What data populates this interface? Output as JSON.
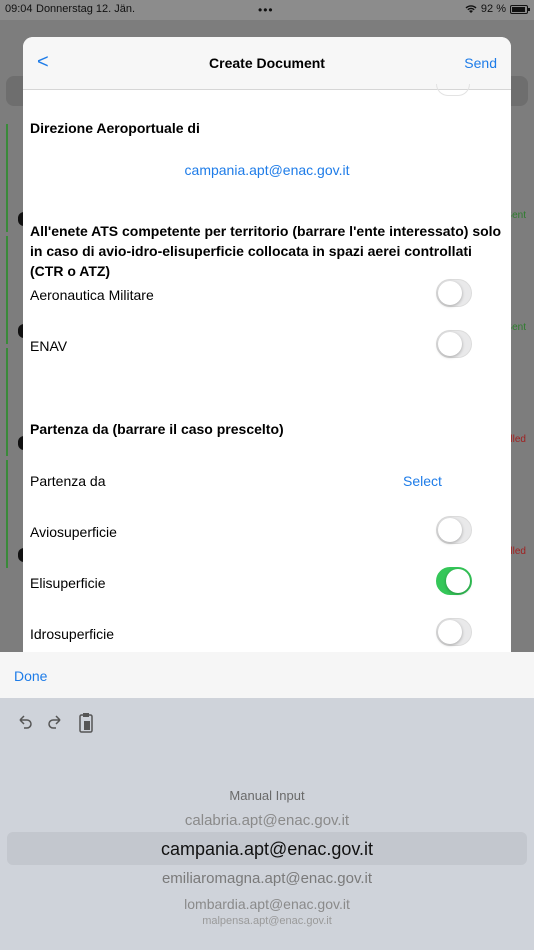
{
  "status": {
    "time": "09:04",
    "date": "Donnerstag 12. Jän.",
    "battery": "92 %"
  },
  "background": {
    "statuses": [
      "Sent",
      "Sent",
      "lled",
      "lled"
    ]
  },
  "header": {
    "back": "<",
    "title": "Create Document",
    "send": "Send"
  },
  "sections": {
    "direzione": {
      "title": "Direzione Aeroportuale di",
      "email": "campania.apt@enac.gov.it"
    },
    "ats": {
      "title": "All'enete ATS competente per territorio (barrare l'ente interessato) solo in caso di avio-idro-elisuperficie collocata in spazi aerei controllati (CTR o ATZ)",
      "rows": [
        {
          "label": "Aeronautica Militare",
          "on": false
        },
        {
          "label": "ENAV",
          "on": false
        }
      ]
    },
    "partenza": {
      "title": "Partenza da (barrare il caso prescelto)",
      "select_label": "Partenza da",
      "select_value": "Select",
      "rows": [
        {
          "label": "Aviosuperficie",
          "on": false
        },
        {
          "label": "Elisuperficie",
          "on": true
        },
        {
          "label": "Idrosuperficie",
          "on": false
        }
      ]
    }
  },
  "done": "Done",
  "picker": {
    "options": [
      "Manual Input",
      "calabria.apt@enac.gov.it",
      "campania.apt@enac.gov.it",
      "emiliaromagna.apt@enac.gov.it",
      "lombardia.apt@enac.gov.it",
      "malpensa.apt@enac.gov.it"
    ],
    "selected_index": 2
  },
  "colors": {
    "accent": "#1e7ce8",
    "toggle_on": "#35c759"
  },
  "icons": [
    "wifi-icon",
    "battery-icon",
    "undo-icon",
    "redo-icon",
    "clipboard-icon"
  ]
}
